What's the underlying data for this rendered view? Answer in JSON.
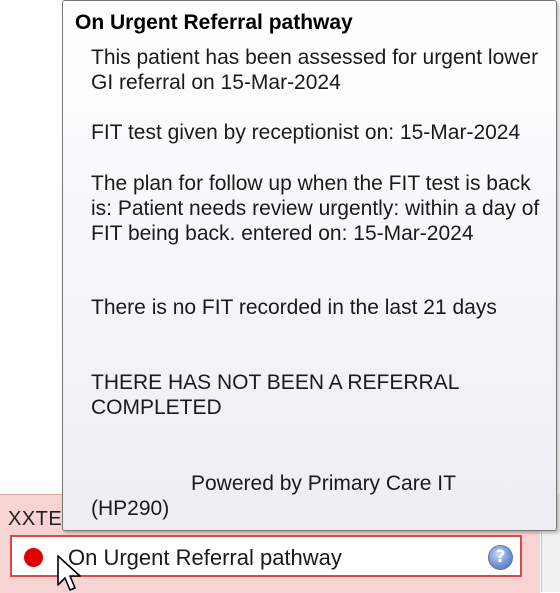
{
  "tooltip": {
    "title": "On Urgent Referral pathway",
    "paragraph_1": "This patient has been assessed for urgent lower GI referral on 15-Mar-2024",
    "paragraph_2": "FIT test given by receptionist on: 15-Mar-2024",
    "paragraph_3": "The plan for follow up when the FIT test is back is: Patient needs review urgently: within a day of FIT being back. entered on: 15-Mar-2024",
    "paragraph_4": "There is no FIT recorded in the last 21 days",
    "paragraph_5": "THERE HAS NOT BEEN A REFERRAL COMPLETED",
    "footer_powered": "Powered by Primary Care IT",
    "footer_code": "(HP290)"
  },
  "panel": {
    "label": "XXTE"
  },
  "status": {
    "text": "On Urgent Referral pathway",
    "indicator_color": "#e00000",
    "help_icon": "help-icon"
  },
  "colors": {
    "panel_background": "#f7d3d3",
    "status_border": "#d84a4a"
  }
}
